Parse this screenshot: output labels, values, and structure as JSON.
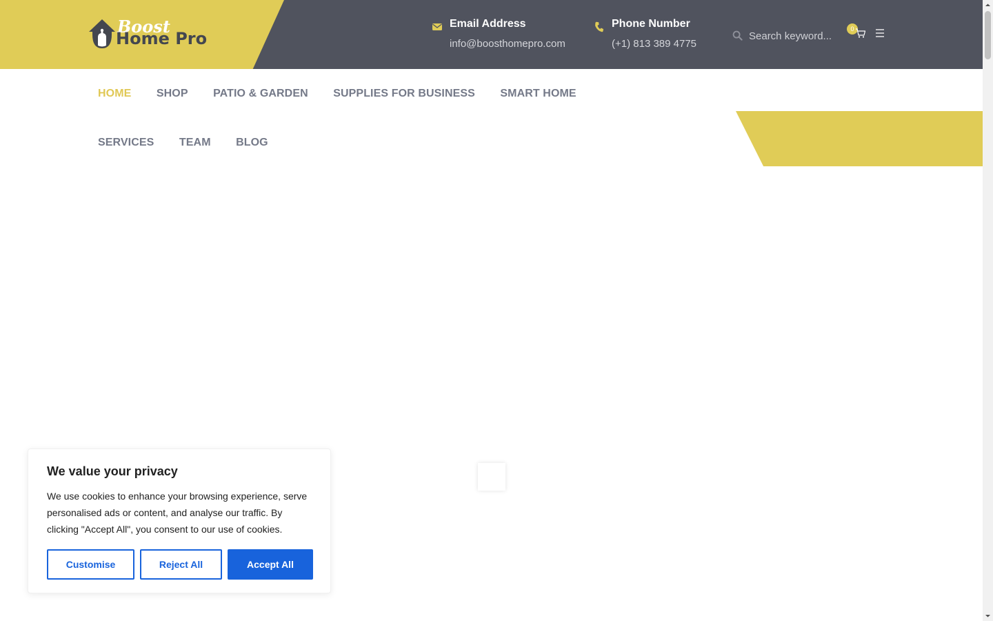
{
  "header": {
    "logo": {
      "script_text": "Boost",
      "main_text": "Home Pro"
    },
    "email": {
      "label": "Email Address",
      "value": "info@boosthomepro.com",
      "icon": "envelope-icon"
    },
    "phone": {
      "label": "Phone Number",
      "value": "(+1) 813 389 4775",
      "icon": "phone-icon"
    },
    "search": {
      "placeholder": "Search keyword...",
      "value": "",
      "icon": "search-icon"
    },
    "cart": {
      "count": "0",
      "icon": "cart-icon"
    },
    "menu_icon": "hamburger-icon"
  },
  "nav": {
    "row1": [
      {
        "label": "HOME",
        "active": true
      },
      {
        "label": "SHOP",
        "active": false
      },
      {
        "label": "PATIO & GARDEN",
        "active": false
      },
      {
        "label": "SUPPLIES FOR BUSINESS",
        "active": false
      },
      {
        "label": "SMART HOME",
        "active": false
      }
    ],
    "row2": [
      {
        "label": "SERVICES",
        "active": false
      },
      {
        "label": "TEAM",
        "active": false
      },
      {
        "label": "BLOG",
        "active": false
      }
    ]
  },
  "cookie_banner": {
    "title": "We value your privacy",
    "text": "We use cookies to enhance your browsing experience, serve personalised ads or content, and analyse our traffic. By clicking \"Accept All\", you consent to our use of cookies.",
    "buttons": {
      "customise": "Customise",
      "reject": "Reject All",
      "accept": "Accept All"
    }
  },
  "colors": {
    "accent_yellow": "#e0cc57",
    "header_dark": "#50535e",
    "nav_text": "#747988",
    "nav_active": "#e0c855",
    "cookie_blue": "#1863dc"
  }
}
